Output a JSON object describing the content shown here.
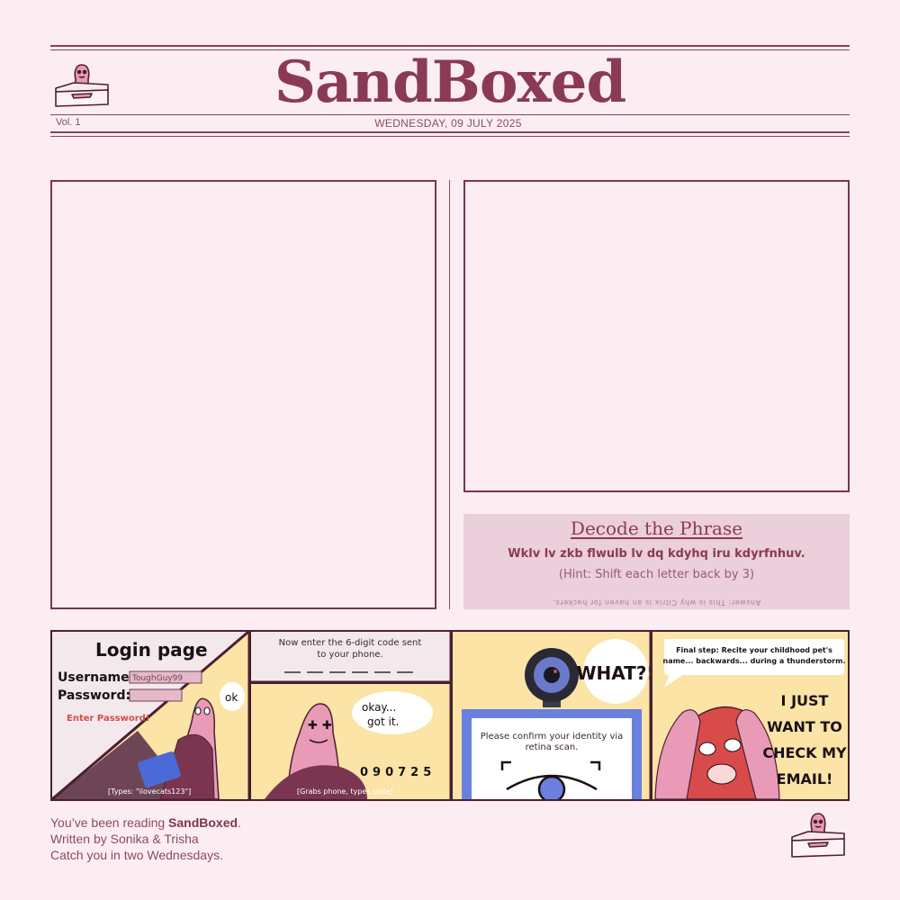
{
  "masthead": {
    "title": "SandBoxed",
    "volume": "Vol. 1",
    "date": "WEDNESDAY, 09 JULY 2025"
  },
  "decode": {
    "title": "Decode the Phrase",
    "cipher": "Wklv lv zkb flwulb lv dq kdyhq iru kdyrfnhuv.",
    "hint": "(Hint: Shift each letter back by 3)",
    "answer": "Answer: This is why Citrix is an haven for hackers."
  },
  "comic": {
    "p1_title": "Login page",
    "p1_username_label": "Username:",
    "p1_username_value": "ToughGuy99",
    "p1_password_label": "Password:",
    "p1_enter_password": "Enter Password!",
    "p1_speech": "ok",
    "p1_caption": "[Types: \"ilovecats123\"]",
    "p2_prompt_line1": "Now enter the 6-digit code sent",
    "p2_prompt_line2": "to your phone.",
    "p2_speech_line1": "okay...",
    "p2_speech_line2": "got it.",
    "p2_code": "090725",
    "p2_caption": "[Grabs phone, types code]",
    "p3_speech": "WHAT?!",
    "p3_prompt_line1": "Please confirm your identity via",
    "p3_prompt_line2": "retina scan.",
    "p4_prompt_line1": "Final step: Recite your childhood pet's",
    "p4_prompt_line2": "name... backwards... during a thunderstorm.",
    "p4_shout_line1": "I JUST",
    "p4_shout_line2": "WANT TO",
    "p4_shout_line3": "CHECK MY",
    "p4_shout_line4": "EMAIL!"
  },
  "footer": {
    "line1_prefix": "You’ve been reading ",
    "line1_brand": "SandBoxed",
    "line1_suffix": ".",
    "line2": "Written by Sonika & Trisha",
    "line3": "Catch you in two Wednesdays."
  },
  "colors": {
    "background": "#fcedf2",
    "ink": "#7a3550",
    "panel_yellow": "#fbe4a6",
    "character_pink": "#e89ab6",
    "decode_bg": "#ebcfda"
  }
}
